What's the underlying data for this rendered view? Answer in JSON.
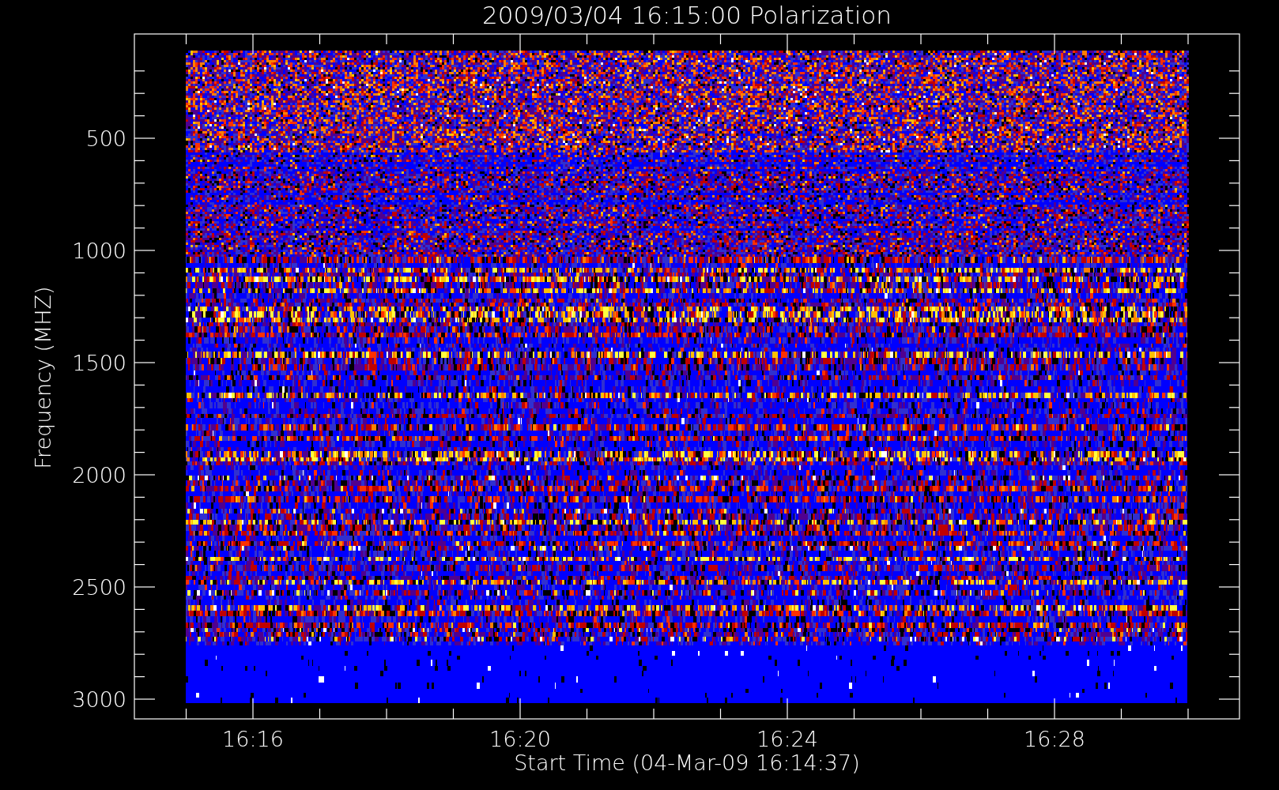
{
  "plot": {
    "title": "2009/03/04 16:15:00 Polarization",
    "ylabel": "Frequency (MHZ)",
    "xlabel": "Start Time (04-Mar-09 16:14:37)",
    "yticks": [
      "500",
      "1000",
      "1500",
      "2000",
      "2500",
      "3000"
    ],
    "xticks": [
      "16:16",
      "16:20",
      "16:24",
      "16:28"
    ]
  }
}
